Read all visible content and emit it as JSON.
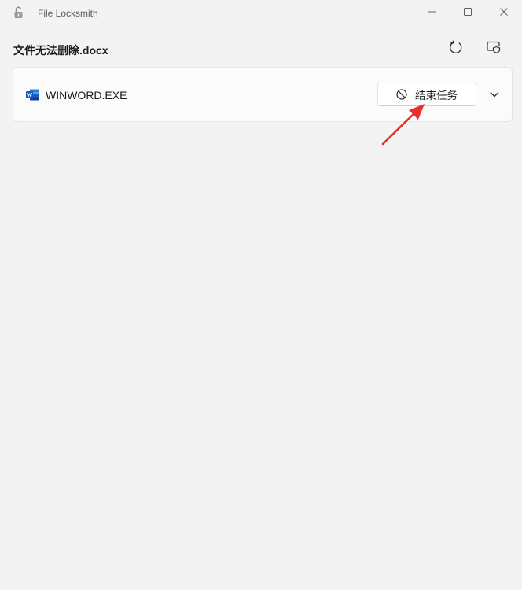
{
  "window": {
    "title": "File Locksmith",
    "icon": "lock-open-icon"
  },
  "caption_buttons": {
    "minimize": "minimize-icon",
    "maximize": "maximize-icon",
    "close": "close-icon"
  },
  "header": {
    "file_name": "文件无法删除.docx",
    "refresh_icon": "refresh-icon",
    "admin_icon": "restart-as-admin-icon"
  },
  "processes": [
    {
      "name": "WINWORD.EXE",
      "icon": "word-icon",
      "end_task_label": "结束任务",
      "end_task_icon": "block-icon",
      "expand_icon": "chevron-down-icon"
    }
  ],
  "colors": {
    "background": "#f3f3f3",
    "card": "#fbfbfb",
    "word_blue": "#185abd",
    "annotation_red": "#e8302a"
  }
}
